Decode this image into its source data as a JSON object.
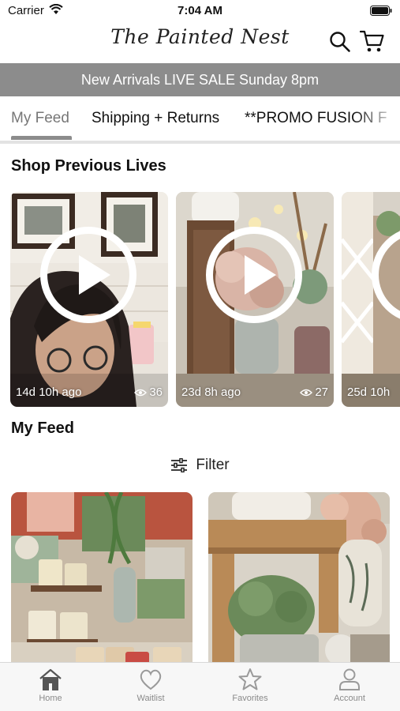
{
  "status_bar": {
    "carrier": "Carrier",
    "time": "7:04 AM"
  },
  "header": {
    "logo_text": "The Painted Nest"
  },
  "banner": {
    "text": "New Arrivals LIVE SALE Sunday 8pm"
  },
  "tabs": [
    {
      "label": "My Feed",
      "active": true
    },
    {
      "label": "Shipping + Returns",
      "active": false
    },
    {
      "label": "**PROMO FUSION F",
      "active": false
    }
  ],
  "lives_section": {
    "title": "Shop Previous Lives",
    "items": [
      {
        "ago": "14d 10h ago",
        "views": "36"
      },
      {
        "ago": "23d 8h ago",
        "views": "27"
      },
      {
        "ago": "25d 10h",
        "views": ""
      }
    ]
  },
  "feed_section": {
    "title": "My Feed",
    "filter_label": "Filter"
  },
  "nav": [
    {
      "label": "Home",
      "icon": "home-icon",
      "active": true
    },
    {
      "label": "Waitlist",
      "icon": "heart-icon",
      "active": false
    },
    {
      "label": "Favorites",
      "icon": "star-icon",
      "active": false
    },
    {
      "label": "Account",
      "icon": "person-icon",
      "active": false
    }
  ],
  "colors": {
    "banner": "#8c8c8c",
    "tab_underline": "#8c8c8c",
    "nav_active": "#555555",
    "nav_inactive": "#9a9a9a"
  }
}
